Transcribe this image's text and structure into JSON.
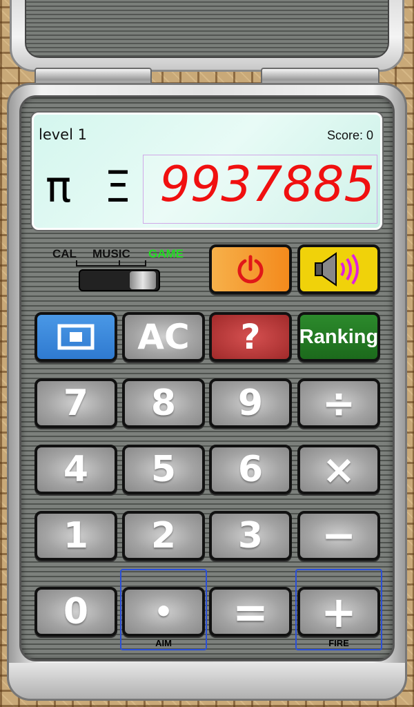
{
  "screen": {
    "level_text": "level 1",
    "score_text": "Score: 0",
    "symbols": "π Ξ",
    "number": "9937885"
  },
  "mode_switch": {
    "options": [
      "CAL",
      "MUSIC",
      "GAME"
    ],
    "selected": "GAME",
    "selected_color": "#22dd22"
  },
  "controls": {
    "power_icon": "power-icon",
    "sound_icon": "speaker-volume-icon"
  },
  "function_row": {
    "screenshot_icon": "screenshot-icon",
    "clear_label": "AC",
    "help_label": "?",
    "ranking_label": "Ranking"
  },
  "keypad": {
    "row1": [
      "7",
      "8",
      "9",
      "÷"
    ],
    "row2": [
      "4",
      "5",
      "6",
      "×"
    ],
    "row3": [
      "1",
      "2",
      "3",
      "−"
    ],
    "row4": [
      "0",
      "•",
      "=",
      "+"
    ]
  },
  "frames": {
    "aim_label": "AIM",
    "fire_label": "FIRE"
  }
}
